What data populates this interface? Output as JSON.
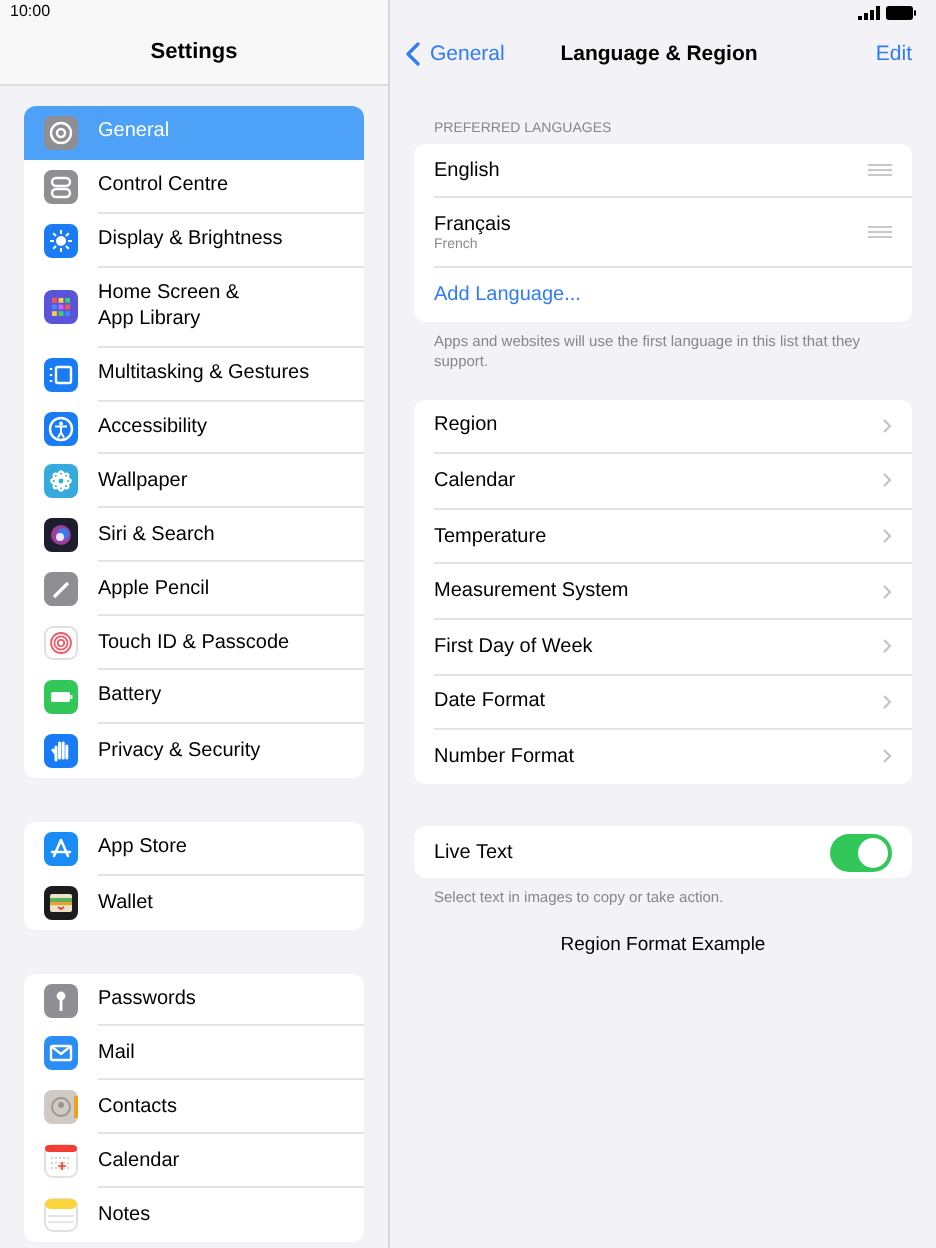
{
  "status_bar": {
    "time": "10:00"
  },
  "sidebar": {
    "title": "Settings",
    "groups": [
      {
        "items": [
          {
            "label": "General",
            "selected": true
          },
          {
            "label": "Control Centre",
            "selected": false
          },
          {
            "label": "Display & Brightness",
            "selected": false
          },
          {
            "label": "Home Screen &\nApp Library",
            "selected": false
          },
          {
            "label": "Multitasking & Gestures",
            "selected": false
          },
          {
            "label": "Accessibility",
            "selected": false
          },
          {
            "label": "Wallpaper",
            "selected": false
          },
          {
            "label": "Siri & Search",
            "selected": false
          },
          {
            "label": "Apple Pencil",
            "selected": false
          },
          {
            "label": "Touch ID & Passcode",
            "selected": false
          },
          {
            "label": "Battery",
            "selected": false
          },
          {
            "label": "Privacy & Security",
            "selected": false
          }
        ]
      },
      {
        "items": [
          {
            "label": "App Store",
            "selected": false
          },
          {
            "label": "Wallet",
            "selected": false
          }
        ]
      },
      {
        "items": [
          {
            "label": "Passwords",
            "selected": false
          },
          {
            "label": "Mail",
            "selected": false
          },
          {
            "label": "Contacts",
            "selected": false
          },
          {
            "label": "Calendar",
            "selected": false
          },
          {
            "label": "Notes",
            "selected": false
          }
        ]
      }
    ]
  },
  "detail": {
    "back": "General",
    "title": "Language & Region",
    "action": "Edit",
    "languages_header": "PREFERRED LANGUAGES",
    "languages": [
      {
        "name": "English"
      },
      {
        "name": "Français",
        "subtitle": "French"
      }
    ],
    "add_language": "Add Language...",
    "languages_footer": "Apps and websites will use the first language in this list that they support.",
    "region_rows": [
      {
        "label": "Region"
      },
      {
        "label": "Calendar"
      },
      {
        "label": "Temperature"
      },
      {
        "label": "Measurement System"
      },
      {
        "label": "First Day of Week"
      },
      {
        "label": "Date Format"
      },
      {
        "label": "Number Format"
      }
    ],
    "live_text": {
      "label": "Live Text",
      "on": true
    },
    "live_text_footer": "Select text in images to copy or take action.",
    "example_title": "Region Format Example"
  }
}
